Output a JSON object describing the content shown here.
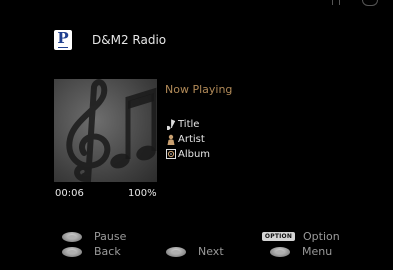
{
  "header": {
    "app_title": "D&M2 Radio",
    "logo_letter": "P"
  },
  "now_playing": {
    "heading": "Now Playing",
    "title": "Title",
    "artist": "Artist",
    "album": "Album"
  },
  "playback": {
    "elapsed": "00:06",
    "volume_percent": "100%"
  },
  "controls": {
    "pause": "Pause",
    "back": "Back",
    "next": "Next",
    "option_badge": "OPTION",
    "option": "Option",
    "menu": "Menu"
  },
  "colors": {
    "accent": "#b18a58",
    "background": "#000000",
    "logo_blue": "#1f3f8f"
  },
  "icons": {
    "title": "music-note-icon",
    "artist": "person-icon",
    "album": "album-icon",
    "buttons": "remote-button-icon"
  }
}
